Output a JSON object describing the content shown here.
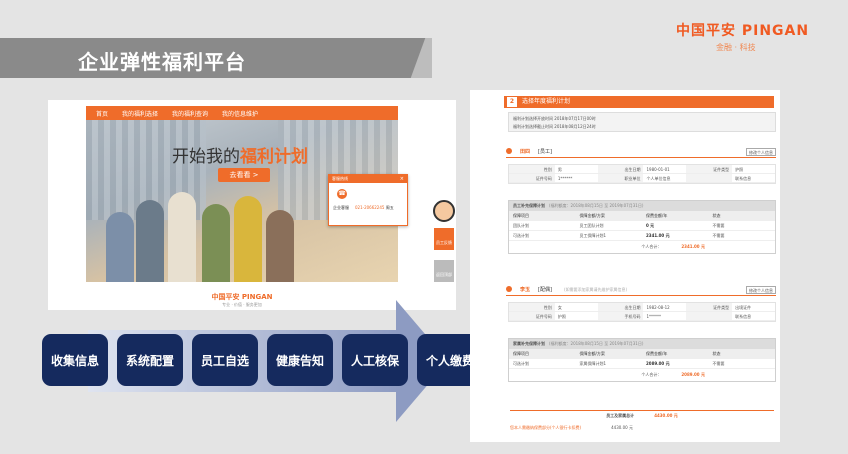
{
  "slide": {
    "title": "企业弹性福利平台"
  },
  "brand": {
    "name": "中国平安 PINGAN",
    "tagline": "金融 · 科技"
  },
  "site": {
    "nav": [
      "首页",
      "我的福利选择",
      "我的福利查询",
      "我的信息维护"
    ],
    "headline_prefix": "开始我的",
    "headline_emph": "福利计划",
    "cta": "去看看 >",
    "popup": {
      "title": "客服热线",
      "close": "×",
      "label": "企业客服",
      "phone": "021-20662245",
      "suffix": "周五"
    },
    "side_btn_1": "员工反馈",
    "side_btn_2": "返回顶部",
    "footer_logo": "中国平安 PINGAN",
    "footer_sub": "专业 · 价值 · 服务更加"
  },
  "flow": {
    "steps": [
      "收集信息",
      "系统配置",
      "员工自选",
      "健康告知",
      "人工核保",
      "个人缴费"
    ]
  },
  "doc": {
    "step_num": "2",
    "step_title": "选择年度福利计划",
    "info": [
      "福利计划选择开放时间 2018年07月17日00时",
      "福利计划选择截止时间 2018年08月12日24时"
    ],
    "employee": {
      "name": "田四",
      "relation": "[员工]",
      "button": "修改个人信息",
      "fields": [
        [
          "性别",
          "男",
          "出生日期",
          "1980-01-01",
          "证件类型",
          "护照"
        ],
        [
          "证件号码",
          "1******",
          "职业单位",
          "个人单位信息",
          "",
          "联系信息"
        ]
      ],
      "plan_title": "员工补充保障计划",
      "plan_note": "(福利额度：2018年08月15日 至 2019年07月31日)",
      "headers": [
        "保障项目",
        "保障金额/方案",
        "保费金额/年",
        "状态"
      ],
      "rows": [
        [
          "团队计划",
          "员工团队计划",
          "0 元",
          "不需要"
        ],
        [
          "可选计划",
          "员工保障计划1",
          "2341.00 元",
          "不需要"
        ]
      ],
      "total_label": "个人合计：",
      "total": "2341.00 元"
    },
    "spouse": {
      "name": "李玉",
      "relation": "[配偶]",
      "note": "(如需要添加家属请先维护家属信息)",
      "button": "修改个人信息",
      "fields": [
        [
          "性别",
          "女",
          "出生日期",
          "1982-08-12",
          "证件类型",
          "出境证件"
        ],
        [
          "证件号码",
          "护照",
          "手机号码",
          "1******",
          "",
          "联系信息"
        ]
      ],
      "plan_title": "家属补充保障计划",
      "plan_note": "(福利额度：2018年08月15日 至 2019年07月31日)",
      "headers": [
        "保障项目",
        "保障金额/方案",
        "保费金额/年",
        "状态"
      ],
      "rows": [
        [
          "可选计划",
          "家属保障计划1",
          "2089.00 元",
          "不需要"
        ]
      ],
      "total_label": "个人合计：",
      "total": "2089.00 元"
    },
    "grand_label": "员工及家属总计",
    "grand_total": "4430.00 元",
    "payroll_label": "您本人需缴纳保费部分(个人银行卡扣费)",
    "payroll_value": "4430.00 元"
  }
}
